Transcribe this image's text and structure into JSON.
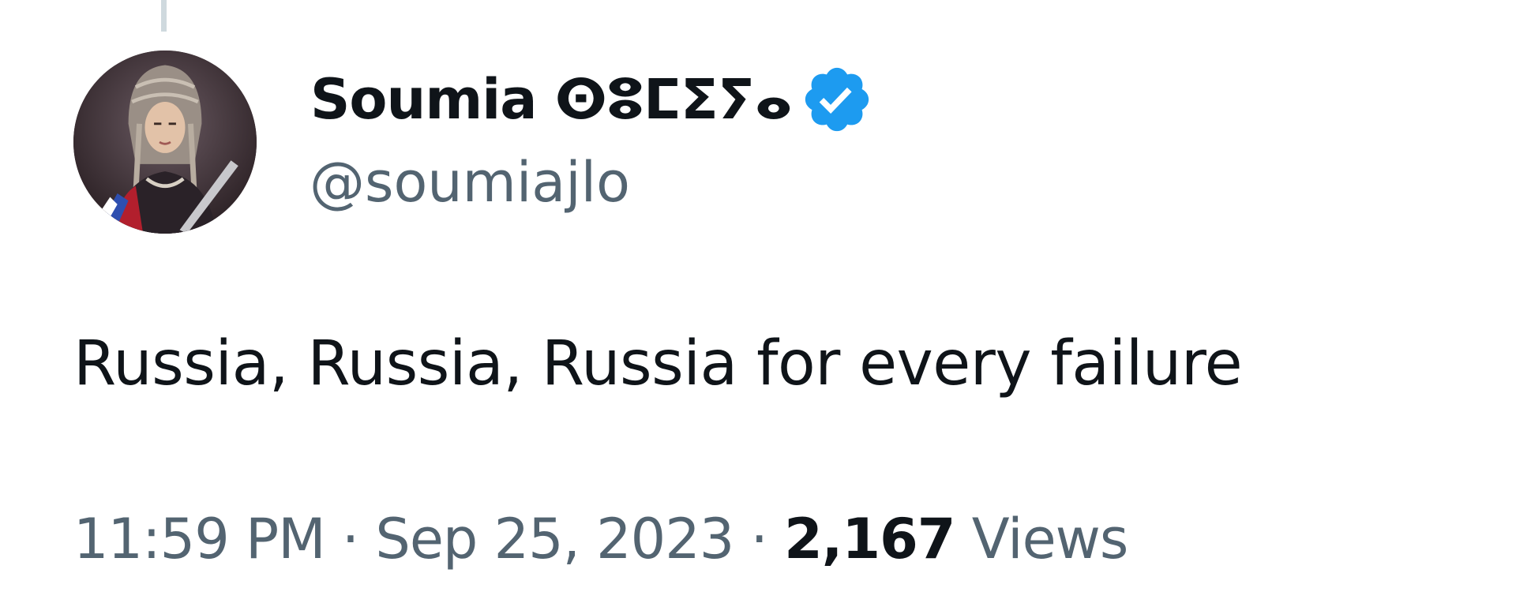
{
  "tweet": {
    "author": {
      "display_name": "Soumia ⵙⵓⵎⵉⵢⴰ",
      "handle": "@soumiajlo",
      "verified": true,
      "avatar_icon": "user-avatar-photo"
    },
    "text": "Russia, Russia, Russia for every failure",
    "meta": {
      "time": "11:59 PM",
      "separator": "·",
      "date": "Sep 25, 2023",
      "views_count": "2,167",
      "views_label": "Views"
    }
  },
  "colors": {
    "primary_text": "#0f1419",
    "secondary_text": "#536471",
    "verified_blue": "#1d9bf0",
    "thread_line": "#cfd9de",
    "background": "#ffffff"
  }
}
